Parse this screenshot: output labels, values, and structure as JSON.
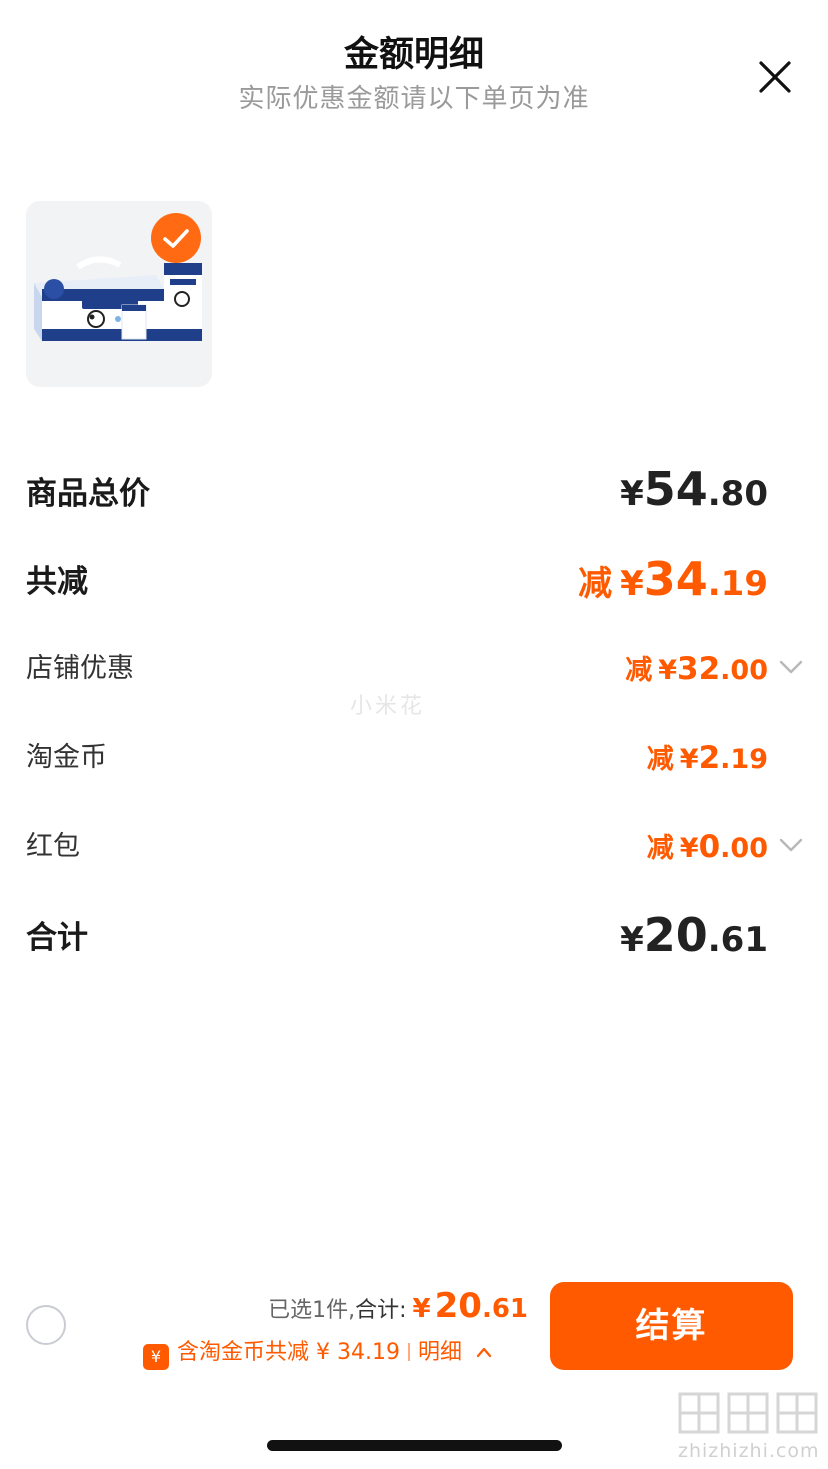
{
  "header": {
    "title": "金额明细",
    "subtitle": "实际优惠金额请以下单页为准",
    "close_icon": "close-icon"
  },
  "product": {
    "image_icon": "milk-carton-box-image",
    "checked": true
  },
  "rows": {
    "total_price": {
      "label": "商品总价",
      "yen": "¥",
      "int": "54",
      "dec": ".80"
    },
    "total_discount": {
      "label": "共减",
      "prefix": "减",
      "yen": "¥",
      "int": "34",
      "dec": ".19"
    },
    "store_discount": {
      "label": "店铺优惠",
      "prefix": "减",
      "yen": "¥",
      "int": "32",
      "dec": ".00",
      "expand_icon": "chevron-down-icon"
    },
    "taojinbi": {
      "label": "淘金币",
      "prefix": "减",
      "yen": "¥",
      "int": "2",
      "dec": ".19"
    },
    "hongbao": {
      "label": "红包",
      "prefix": "减",
      "yen": "¥",
      "int": "0",
      "dec": ".00",
      "expand_icon": "chevron-down-icon"
    },
    "grand_total": {
      "label": "合计",
      "yen": "¥",
      "int": "20",
      "dec": ".61"
    }
  },
  "watermark": "小米花",
  "bottom": {
    "selected_text": "已选1件,",
    "total_label": "合计:",
    "yen": "¥",
    "int": "20",
    "dec": ".61",
    "discount_text": "含淘金币共减 ¥ 34.19",
    "detail_text": "明细",
    "coin_badge": "¥",
    "checkout_label": "结算"
  },
  "footer": {
    "site_url": "zhizhizhi.com"
  },
  "colors": {
    "accent": "#ff5a00",
    "check_badge": "#ff6a13",
    "text_main": "#1a1a1a",
    "text_muted": "#9a9a9a"
  }
}
